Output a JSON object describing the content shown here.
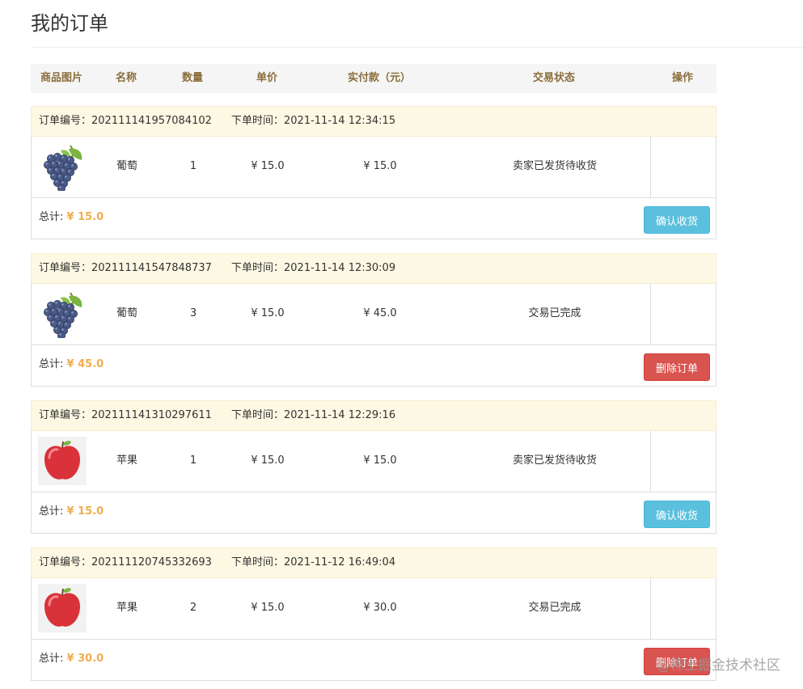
{
  "page": {
    "title": "我的订单"
  },
  "table_header": {
    "image": "商品图片",
    "name": "名称",
    "quantity": "数量",
    "unit_price": "单价",
    "paid": "实付款（元）",
    "status": "交易状态",
    "action": "操作"
  },
  "labels": {
    "order_no": "订单编号：",
    "order_time": "下单时间：",
    "total": "总计:"
  },
  "orders": [
    {
      "order_no": "202111141957084102",
      "time": "2021-11-14 12:34:15",
      "product": "葡萄",
      "product_icon": "grapes-image",
      "quantity": "1",
      "unit_price": "¥ 15.0",
      "paid": "¥ 15.0",
      "status": "卖家已发货待收货",
      "total": "¥ 15.0",
      "action": "确认收货",
      "action_type": "confirm"
    },
    {
      "order_no": "202111141547848737",
      "time": "2021-11-14 12:30:09",
      "product": "葡萄",
      "product_icon": "grapes-image",
      "quantity": "3",
      "unit_price": "¥ 15.0",
      "paid": "¥ 45.0",
      "status": "交易已完成",
      "total": "¥ 45.0",
      "action": "删除订单",
      "action_type": "delete"
    },
    {
      "order_no": "202111141310297611",
      "time": "2021-11-14 12:29:16",
      "product": "苹果",
      "product_icon": "apple-image",
      "quantity": "1",
      "unit_price": "¥ 15.0",
      "paid": "¥ 15.0",
      "status": "卖家已发货待收货",
      "total": "¥ 15.0",
      "action": "确认收货",
      "action_type": "confirm"
    },
    {
      "order_no": "202111120745332693",
      "time": "2021-11-12 16:49:04",
      "product": "苹果",
      "product_icon": "apple-image",
      "quantity": "2",
      "unit_price": "¥ 15.0",
      "paid": "¥ 30.0",
      "status": "交易已完成",
      "total": "¥ 30.0",
      "action": "删除订单",
      "action_type": "delete"
    }
  ],
  "colors": {
    "confirm_button": "#5bc0de",
    "delete_button": "#d9534f",
    "total_value": "#f0ad4e",
    "order_header_bg": "#fcf8e3"
  },
  "watermark": "@稀土掘金技术社区"
}
